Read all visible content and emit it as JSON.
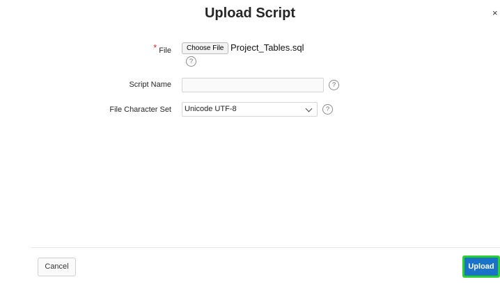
{
  "dialog": {
    "title": "Upload Script",
    "close_glyph": "×"
  },
  "form": {
    "file": {
      "required_marker": "*",
      "label": "File",
      "choose_button": "Choose File",
      "selected_file": "Project_Tables.sql",
      "help_glyph": "?"
    },
    "script_name": {
      "label": "Script Name",
      "value": "",
      "help_glyph": "?"
    },
    "character_set": {
      "label": "File Character Set",
      "selected": "Unicode UTF-8",
      "help_glyph": "?"
    }
  },
  "footer": {
    "cancel_label": "Cancel",
    "upload_label": "Upload"
  },
  "icons": {
    "close": "close-icon",
    "help": "help-icon",
    "dropdown": "chevron-down-icon"
  },
  "colors": {
    "required": "#d7262d",
    "primary": "#1a73c9",
    "focus_outline": "#2bd22b"
  }
}
